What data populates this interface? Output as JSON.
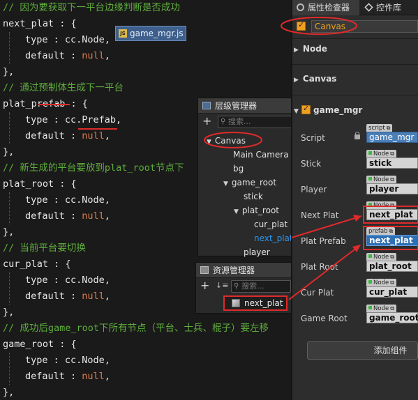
{
  "code": {
    "lines": [
      {
        "text": "// 因为要获取下一平台边缘判断是否成功",
        "kind": "comment"
      },
      {
        "text": "next_plat : {",
        "kind": "code"
      },
      {
        "text": "type : cc.Node,",
        "kind": "prop"
      },
      {
        "text": "default : null,",
        "kind": "prop"
      },
      {
        "text": "},",
        "kind": "code"
      },
      {
        "text": "// 通过预制体生成下一平台",
        "kind": "comment"
      },
      {
        "text": "plat_prefab : {",
        "kind": "code"
      },
      {
        "text": "type : cc.Prefab,",
        "kind": "prop"
      },
      {
        "text": "default : null,",
        "kind": "prop"
      },
      {
        "text": "},",
        "kind": "code"
      },
      {
        "text": "// 新生成的平台要放到plat_root节点下",
        "kind": "comment"
      },
      {
        "text": "plat_root : {",
        "kind": "code"
      },
      {
        "text": "type : cc.Node,",
        "kind": "prop"
      },
      {
        "text": "default : null,",
        "kind": "prop"
      },
      {
        "text": "},",
        "kind": "code"
      },
      {
        "text": "// 当前平台要切换",
        "kind": "comment"
      },
      {
        "text": "cur_plat : {",
        "kind": "code"
      },
      {
        "text": "type : cc.Node,",
        "kind": "prop"
      },
      {
        "text": "default : null,",
        "kind": "prop"
      },
      {
        "text": "},",
        "kind": "code"
      },
      {
        "text": "// 成功后game_root下所有节点（平台、士兵、棍子）要左移",
        "kind": "comment"
      },
      {
        "text": "game_root : {",
        "kind": "code"
      },
      {
        "text": "type : cc.Node,",
        "kind": "prop"
      },
      {
        "text": "default : null,",
        "kind": "prop"
      },
      {
        "text": "},",
        "kind": "code"
      }
    ]
  },
  "file_tab": {
    "label": "game_mgr.js",
    "icon": "JS"
  },
  "hierarchy": {
    "title": "层级管理器",
    "search_placeholder": "搜索...",
    "nodes": [
      {
        "label": "Canvas",
        "expanded": true
      },
      {
        "label": "Main Camera"
      },
      {
        "label": "bg"
      },
      {
        "label": "game_root",
        "expanded": true
      },
      {
        "label": "stick"
      },
      {
        "label": "plat_root",
        "expanded": true
      },
      {
        "label": "cur_plat"
      },
      {
        "label": "next_plat"
      },
      {
        "label": "player"
      }
    ]
  },
  "assets": {
    "title": "资源管理器",
    "search_placeholder": "搜索...",
    "item": "next_plat"
  },
  "inspector": {
    "tabs": [
      "属性检查器",
      "控件库"
    ],
    "node_name": "Canvas",
    "sections": [
      "Node",
      "Canvas",
      "game_mgr"
    ],
    "properties": [
      {
        "label": "Script",
        "tag": "script",
        "value": "game_mgr"
      },
      {
        "label": "Stick",
        "tag": "Node",
        "value": "stick"
      },
      {
        "label": "Player",
        "tag": "Node",
        "value": "player"
      },
      {
        "label": "Next Plat",
        "tag": "Node",
        "value": "next_plat"
      },
      {
        "label": "Plat Prefab",
        "tag": "prefab",
        "value": "next_plat"
      },
      {
        "label": "Plat Root",
        "tag": "Node",
        "value": "plat_root"
      },
      {
        "label": "Cur Plat",
        "tag": "Node",
        "value": "cur_plat"
      },
      {
        "label": "Game Root",
        "tag": "Node",
        "value": "game_root"
      }
    ],
    "add_component": "添加组件"
  },
  "colors": {
    "comment": "#5fae3c",
    "null_literal": "#e07c4c",
    "accent_orange": "#f0a020",
    "selection_blue": "#2e95e8",
    "annotation_red": "#e02a2a"
  }
}
